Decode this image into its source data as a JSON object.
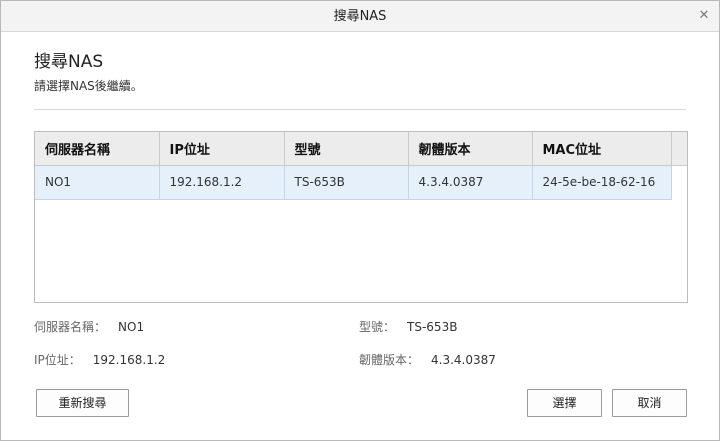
{
  "window": {
    "title": "搜尋NAS"
  },
  "heading": "搜尋NAS",
  "subheading": "請選擇NAS後繼續。",
  "table": {
    "columns": [
      "伺服器名稱",
      "IP位址",
      "型號",
      "韌體版本",
      "MAC位址"
    ],
    "rows": [
      [
        "NO1",
        "192.168.1.2",
        "TS-653B",
        "4.3.4.0387",
        "24-5e-be-18-62-16"
      ]
    ]
  },
  "details": {
    "server_name_label": "伺服器名稱：",
    "server_name_value": "NO1",
    "model_label": "型號：",
    "model_value": "TS-653B",
    "ip_label": "IP位址：",
    "ip_value": "192.168.1.2",
    "firmware_label": "韌體版本：",
    "firmware_value": "4.3.4.0387"
  },
  "buttons": {
    "rescan": "重新搜尋",
    "select": "選擇",
    "cancel": "取消"
  }
}
